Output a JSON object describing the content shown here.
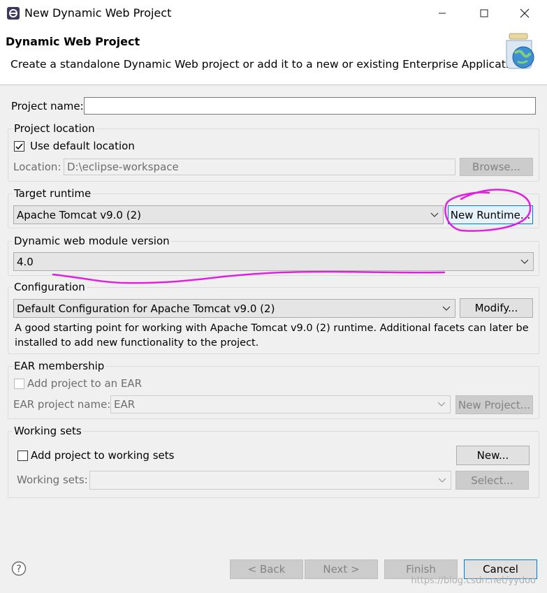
{
  "window": {
    "title": "New Dynamic Web Project",
    "app_icon": "eclipse-icon",
    "controls": [
      "minimize-icon",
      "maximize-icon",
      "close-icon"
    ]
  },
  "banner": {
    "title": "Dynamic Web Project",
    "description": "Create a standalone Dynamic Web project or add it to a new or existing Enterprise Application.",
    "icon": "web-project-globe-icon"
  },
  "project_name": {
    "label": "Project name:",
    "value": ""
  },
  "project_location": {
    "group_label": "Project location",
    "use_default_label": "Use default location",
    "use_default_checked": true,
    "location_label": "Location:",
    "location_value": "D:\\eclipse-workspace",
    "browse_label": "Browse..."
  },
  "target_runtime": {
    "group_label": "Target runtime",
    "selected": "Apache Tomcat v9.0 (2)",
    "new_runtime_label": "New Runtime..."
  },
  "web_module": {
    "group_label": "Dynamic web module version",
    "selected": "4.0"
  },
  "configuration": {
    "group_label": "Configuration",
    "selected": "Default Configuration for Apache Tomcat v9.0 (2)",
    "modify_label": "Modify...",
    "description_line1": "A good starting point for working with Apache Tomcat v9.0 (2) runtime. Additional facets can later be",
    "description_line2": "installed to add new functionality to the project."
  },
  "ear": {
    "group_label": "EAR membership",
    "add_label": "Add project to an EAR",
    "add_checked": false,
    "name_label": "EAR project name:",
    "name_value": "EAR",
    "new_project_label": "New Project..."
  },
  "working_sets": {
    "group_label": "Working sets",
    "add_label": "Add project to working sets",
    "add_checked": false,
    "new_label": "New...",
    "sets_label": "Working sets:",
    "sets_value": "",
    "select_label": "Select..."
  },
  "footer": {
    "help_icon": "help-icon",
    "back_label": "< Back",
    "next_label": "Next >",
    "finish_label": "Finish",
    "cancel_label": "Cancel"
  },
  "watermark": "https://blog.csdn.net/yydoo",
  "annotation_color": "#e020e0"
}
